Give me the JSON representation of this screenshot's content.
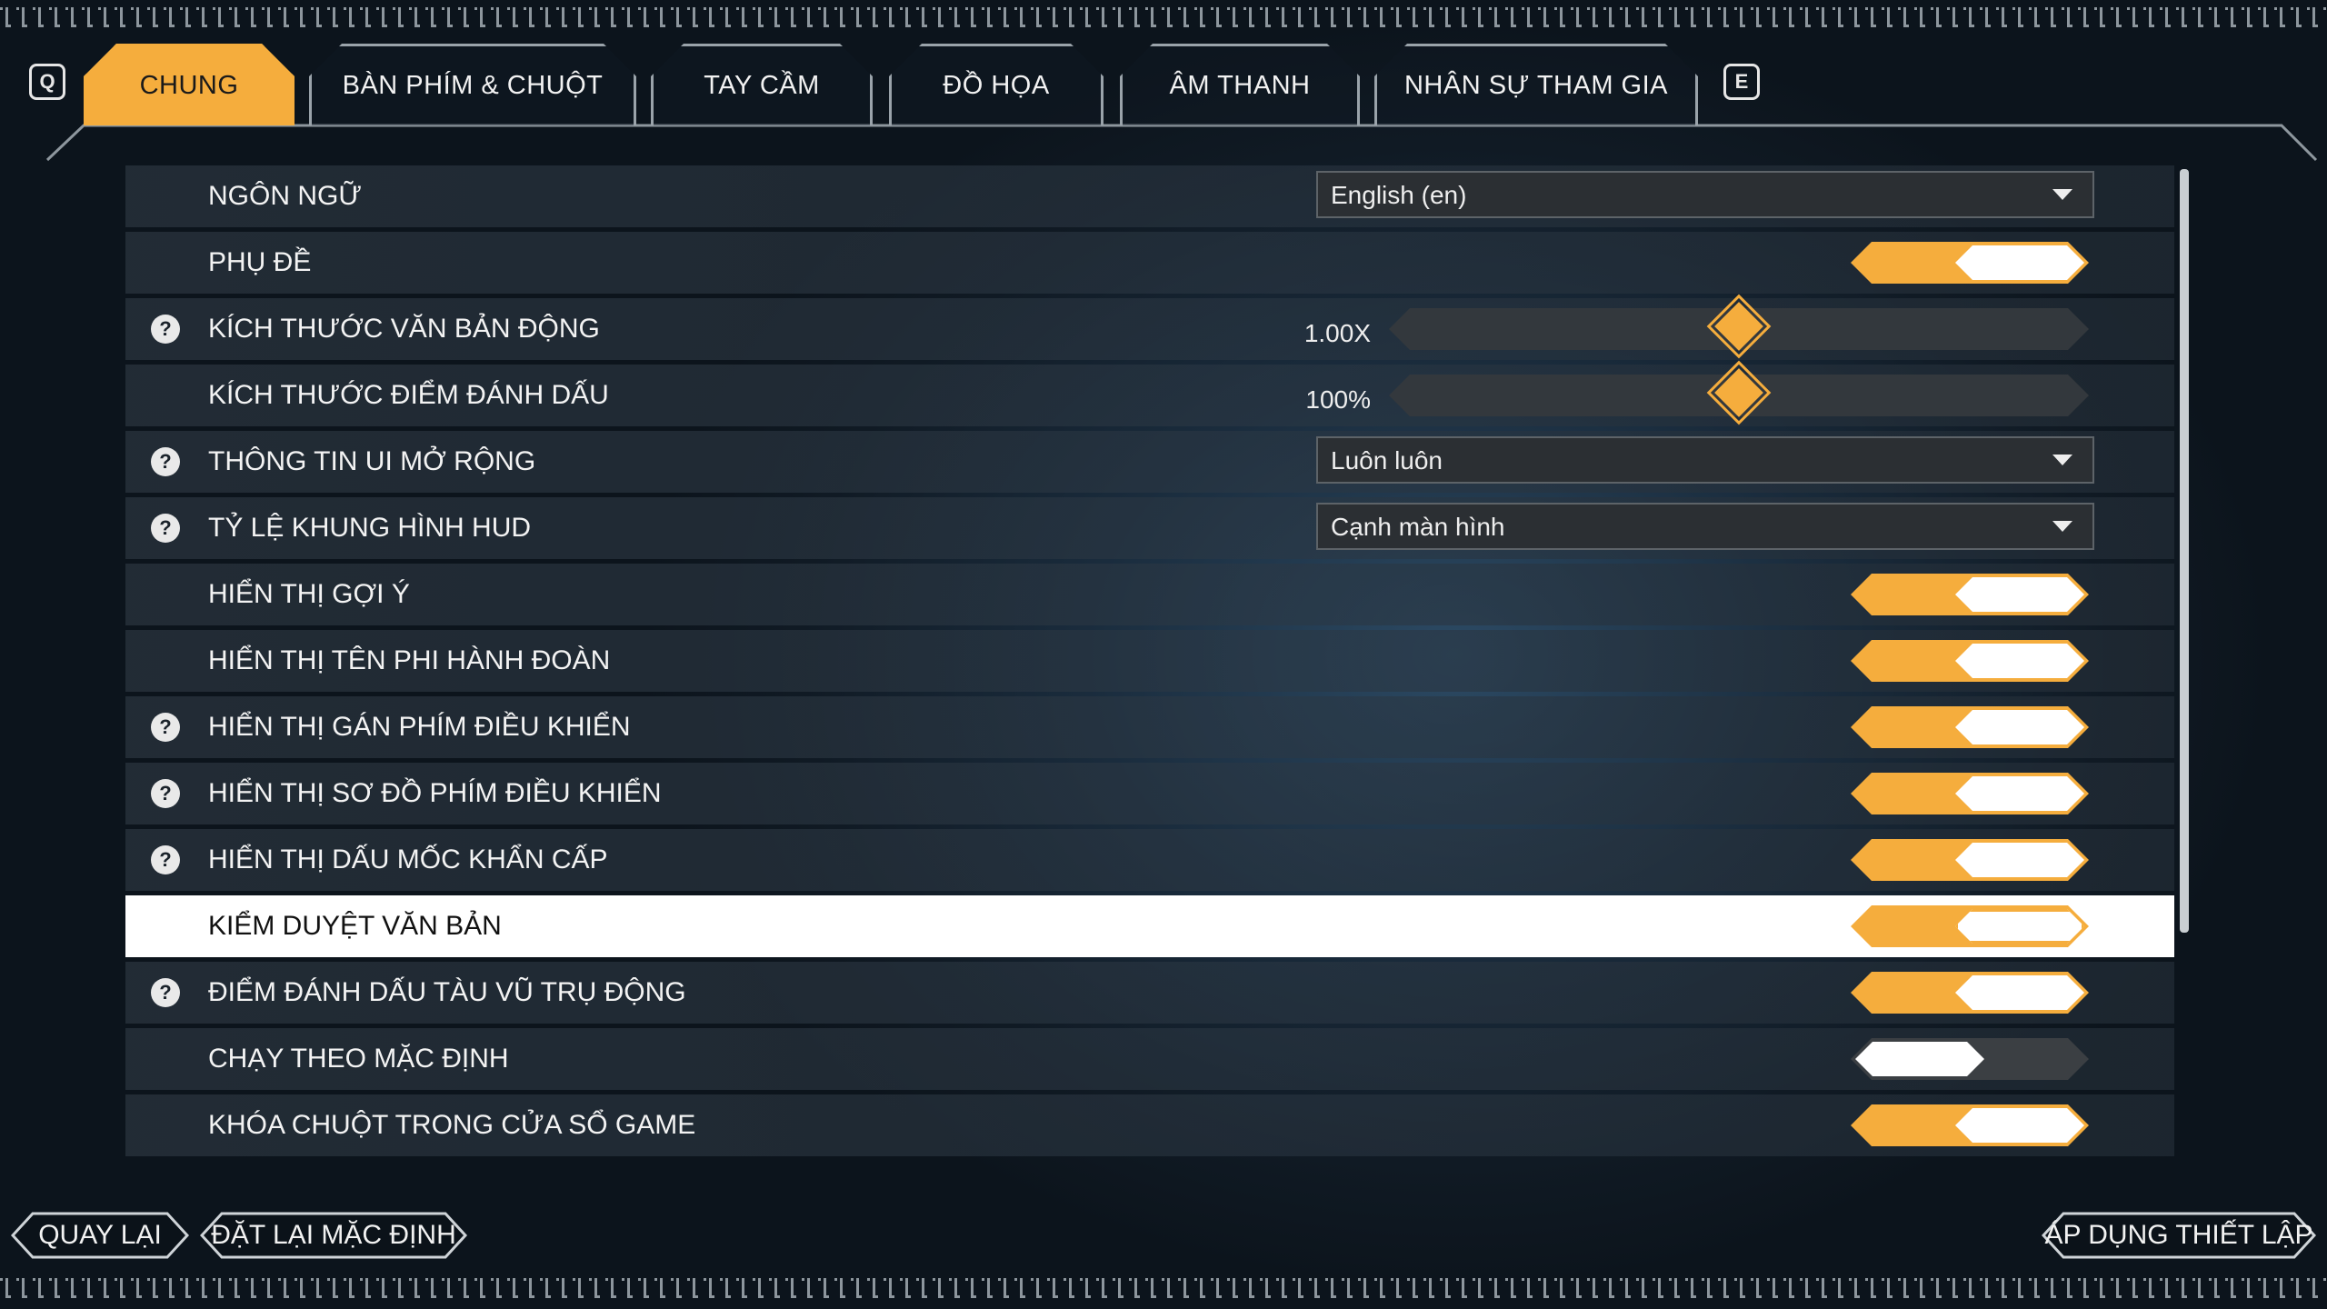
{
  "hints": {
    "prev_key": "Q",
    "next_key": "E"
  },
  "tabs": [
    {
      "label": "CHUNG",
      "active": true
    },
    {
      "label": "BÀN PHÍM & CHUỘT",
      "active": false
    },
    {
      "label": "TAY CẦM",
      "active": false
    },
    {
      "label": "ĐỒ HỌA",
      "active": false
    },
    {
      "label": "ÂM THANH",
      "active": false
    },
    {
      "label": "NHÂN SỰ THAM GIA",
      "active": false
    }
  ],
  "settings": [
    {
      "label": "NGÔN NGỮ",
      "help": false,
      "control": "dropdown",
      "value": "English (en)"
    },
    {
      "label": "PHỤ ĐỀ",
      "help": false,
      "control": "toggle",
      "on": true
    },
    {
      "label": "KÍCH THƯỚC VĂN BẢN ĐỘNG",
      "help": true,
      "control": "slider",
      "value": "1.00X",
      "level": 0.5
    },
    {
      "label": "KÍCH THƯỚC ĐIỂM ĐÁNH DẤU",
      "help": false,
      "control": "slider",
      "value": "100%",
      "level": 0.5
    },
    {
      "label": "THÔNG TIN UI MỞ RỘNG",
      "help": true,
      "control": "dropdown",
      "value": "Luôn luôn"
    },
    {
      "label": "TỶ LỆ KHUNG HÌNH HUD",
      "help": true,
      "control": "dropdown",
      "value": "Cạnh màn hình"
    },
    {
      "label": "HIỂN THỊ GỢI Ý",
      "help": false,
      "control": "toggle",
      "on": true
    },
    {
      "label": "HIỂN THỊ TÊN PHI HÀNH ĐOÀN",
      "help": false,
      "control": "toggle",
      "on": true
    },
    {
      "label": "HIỂN THỊ GÁN PHÍM ĐIỀU KHIỂN",
      "help": true,
      "control": "toggle",
      "on": true
    },
    {
      "label": "HIỂN THỊ SƠ ĐỒ PHÍM ĐIỀU KHIỂN",
      "help": true,
      "control": "toggle",
      "on": true
    },
    {
      "label": "HIỂN THỊ DẤU MỐC KHẨN CẤP",
      "help": true,
      "control": "toggle",
      "on": true
    },
    {
      "label": "KIỂM DUYỆT VĂN BẢN",
      "help": false,
      "control": "toggle",
      "on": true,
      "selected": true
    },
    {
      "label": "ĐIỂM ĐÁNH DẤU TÀU VŨ TRỤ ĐỘNG",
      "help": true,
      "control": "toggle",
      "on": true
    },
    {
      "label": "CHẠY THEO MẶC ĐỊNH",
      "help": false,
      "control": "toggle",
      "on": false
    },
    {
      "label": "KHÓA CHUỘT TRONG CỬA SỔ GAME",
      "help": false,
      "control": "toggle",
      "on": true
    }
  ],
  "help_glyph": "?",
  "footer": {
    "back_label": "QUAY LẠI",
    "reset_label": "ĐẶT LẠI MẶC ĐỊNH",
    "apply_label": "ÁP DỤNG THIẾT LẬP"
  },
  "colors": {
    "accent": "#f5ad3d",
    "row_selected": "#ffffff",
    "toggle_off": "#3b3f43"
  }
}
